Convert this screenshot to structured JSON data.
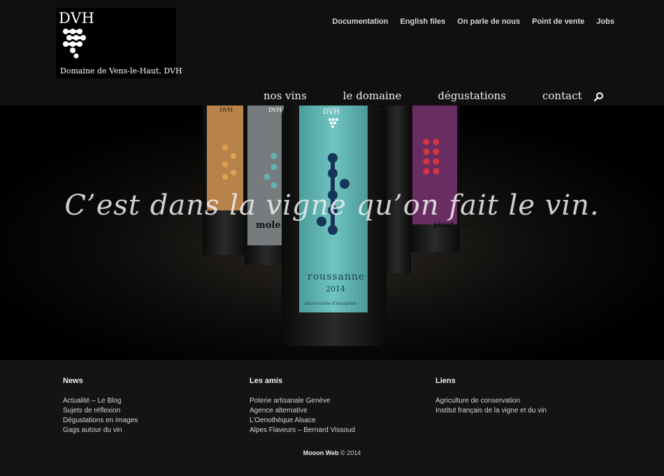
{
  "logo": {
    "mark": "DVH",
    "name": "Domaine de Vens-le-Haut, DVH"
  },
  "topnav": [
    "Documentation",
    "English files",
    "On parle de nous",
    "Point de vente",
    "Jobs"
  ],
  "mainnav": [
    "nos vins",
    "le domaine",
    "dégustations",
    "contact"
  ],
  "search_icon": "search-icon",
  "hero": {
    "tagline": "C’est dans la vigne qu’on fait le vin.",
    "bottle_labels": {
      "front_mark": "DVH",
      "front_name": "roussanne",
      "front_year": "2014",
      "front_sub": "micro-cuvée d'exception",
      "left_mark": "DVH",
      "left2_mark": "DVH",
      "left2_name": "mole",
      "right_name": "pinot noir"
    },
    "colors": {
      "front": "#63b8b6",
      "orange": "#c0894a",
      "grey": "#7a7e80",
      "purple": "#6a2d62"
    }
  },
  "footer": {
    "columns": [
      {
        "title": "News",
        "items": [
          "Actualité – Le Blog",
          "Sujets de réflexion",
          "Dégustations en images",
          "Gags autour du vin"
        ]
      },
      {
        "title": "Les amis",
        "items": [
          "Poterie artisanale Genève",
          "Agence alternative",
          "L’Oenothèque Alsace",
          "Alpes Flaveurs – Bernard Vissoud"
        ]
      },
      {
        "title": "Liens",
        "items": [
          "Agriculture de conservation",
          "Institut français de la vigne et du vin"
        ]
      }
    ],
    "copyright_brand": "Mooon Web",
    "copyright_rest": " © 2014"
  }
}
